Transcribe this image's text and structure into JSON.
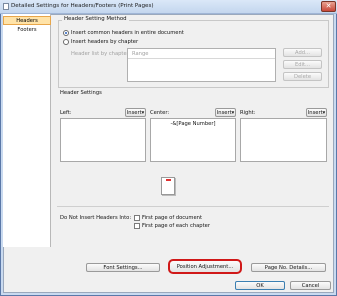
{
  "window": {
    "title": "Detailed Settings for Headers/Footers (Print Pages)",
    "close_symbol": "✕"
  },
  "sidebar": {
    "items": [
      {
        "label": "Headers",
        "selected": true
      },
      {
        "label": "Footers",
        "selected": false
      }
    ]
  },
  "header_method": {
    "group_label": "Header Setting Method",
    "option_common": "Insert common headers in entire document",
    "option_by_chapter": "Insert headers by chapter",
    "selected": "common",
    "list_label": "Header list by chapter:",
    "list_column": "Range",
    "add_label": "Add...",
    "edit_label": "Edit...",
    "delete_label": "Delete"
  },
  "header_settings": {
    "group_label": "Header Settings",
    "left_label": "Left:",
    "center_label": "Center:",
    "right_label": "Right:",
    "insert_label": "Insert▾",
    "left_value": "",
    "center_value": "-&[Page Number]",
    "right_value": ""
  },
  "no_insert": {
    "label": "Do Not Insert Headers Into:",
    "first_page_doc": "First page of document",
    "first_page_chapter": "First page of each chapter"
  },
  "buttons": {
    "font_settings": "Font Settings...",
    "position_adjustment": "Position Adjustment...",
    "page_no_details": "Page No. Details...",
    "ok": "OK",
    "cancel": "Cancel"
  },
  "colors": {
    "selected_item_bg": "#ffe3a8",
    "highlight_border": "#d01818",
    "radio_dot": "#2a62c0"
  }
}
